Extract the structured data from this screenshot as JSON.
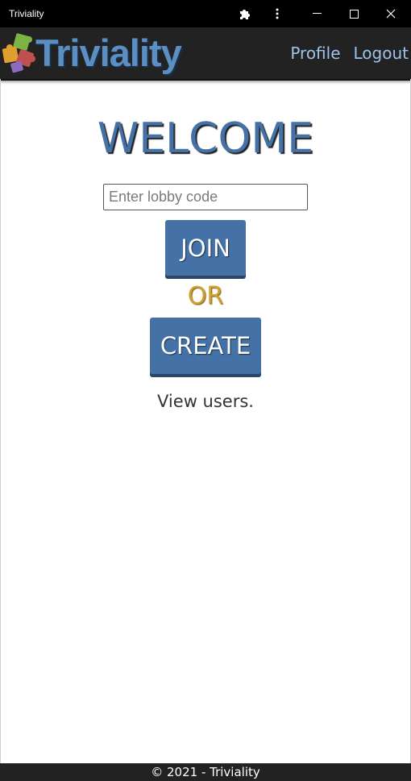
{
  "window": {
    "title": "Triviality",
    "controls": [
      "puzzle-icon",
      "more-vertical-icon",
      "minimize-icon",
      "maximize-icon",
      "close-icon"
    ]
  },
  "navbar": {
    "brand": "Triviality",
    "links": [
      {
        "label": "Profile"
      },
      {
        "label": "Logout"
      }
    ]
  },
  "main": {
    "heading": "WELCOME",
    "lobby_input": {
      "placeholder": "Enter lobby code",
      "value": ""
    },
    "join_label": "JOIN",
    "or_label": "OR",
    "create_label": "CREATE",
    "view_users": "View users."
  },
  "footer": {
    "text": "© 2021 - Triviality"
  },
  "colors": {
    "brand_blue": "#4472a7",
    "nav_link": "#9ec3ea",
    "accent_gold": "#d0a030",
    "navbar_bg": "#222222"
  }
}
